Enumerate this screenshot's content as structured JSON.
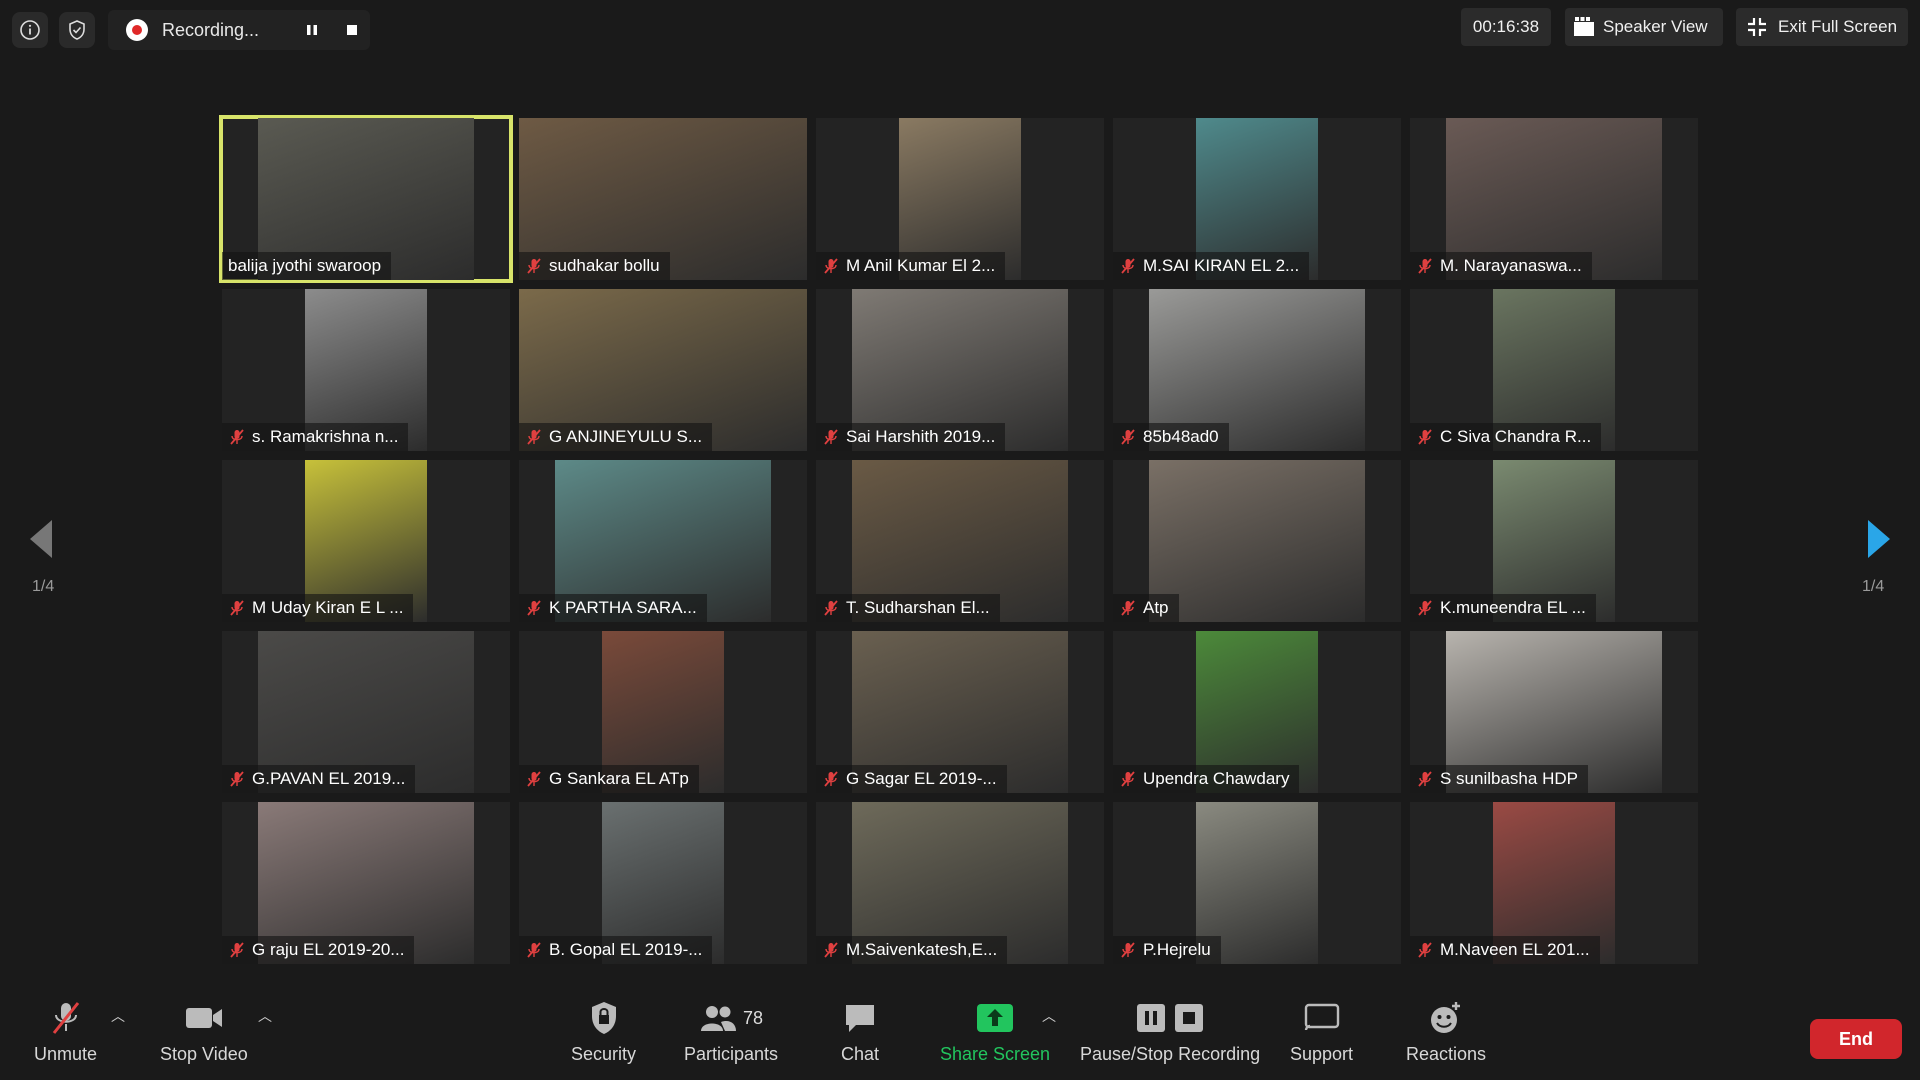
{
  "topbar": {
    "recording_label": "Recording...",
    "timer": "00:16:38",
    "speaker_view_label": "Speaker View",
    "exit_fullscreen_label": "Exit Full Screen"
  },
  "gallery": {
    "page_indicator_left": "1/4",
    "page_indicator_right": "1/4",
    "active_border_color": "#d8e46a",
    "participants": [
      {
        "name": "balija jyothi swaroop",
        "muted": false,
        "active": true
      },
      {
        "name": "sudhakar bollu",
        "muted": true
      },
      {
        "name": "M Anil Kumar El 2...",
        "muted": true
      },
      {
        "name": "M.SAI KIRAN EL 2...",
        "muted": true
      },
      {
        "name": "M. Narayanaswa...",
        "muted": true
      },
      {
        "name": "s. Ramakrishna n...",
        "muted": true
      },
      {
        "name": "G ANJINEYULU S...",
        "muted": true
      },
      {
        "name": "Sai Harshith 2019...",
        "muted": true
      },
      {
        "name": "85b48ad0",
        "muted": true
      },
      {
        "name": "C Siva Chandra R...",
        "muted": true
      },
      {
        "name": "M Uday Kiran E L ...",
        "muted": true
      },
      {
        "name": "K PARTHA  SARA...",
        "muted": true
      },
      {
        "name": "T. Sudharshan  El...",
        "muted": true
      },
      {
        "name": "Atp",
        "muted": true
      },
      {
        "name": "K.muneendra EL ...",
        "muted": true
      },
      {
        "name": "G.PAVAN EL 2019...",
        "muted": true
      },
      {
        "name": "G Sankara EL ATp",
        "muted": true
      },
      {
        "name": "G Sagar EL 2019-...",
        "muted": true
      },
      {
        "name": "Upendra Chawdary",
        "muted": true
      },
      {
        "name": "S sunilbasha HDP",
        "muted": true
      },
      {
        "name": "G raju EL 2019-20...",
        "muted": true
      },
      {
        "name": "B. Gopal EL 2019-...",
        "muted": true
      },
      {
        "name": "M.Saivenkatesh,E...",
        "muted": true
      },
      {
        "name": "P.Hejrelu",
        "muted": true
      },
      {
        "name": "M.Naveen EL 201...",
        "muted": true
      }
    ]
  },
  "toolbar": {
    "unmute_label": "Unmute",
    "stop_video_label": "Stop Video",
    "security_label": "Security",
    "participants_label": "Participants",
    "participants_count": "78",
    "chat_label": "Chat",
    "share_screen_label": "Share Screen",
    "pause_stop_recording_label": "Pause/Stop Recording",
    "support_label": "Support",
    "reactions_label": "Reactions",
    "end_label": "End",
    "share_color": "#22c55e",
    "end_color": "#d1262c"
  }
}
